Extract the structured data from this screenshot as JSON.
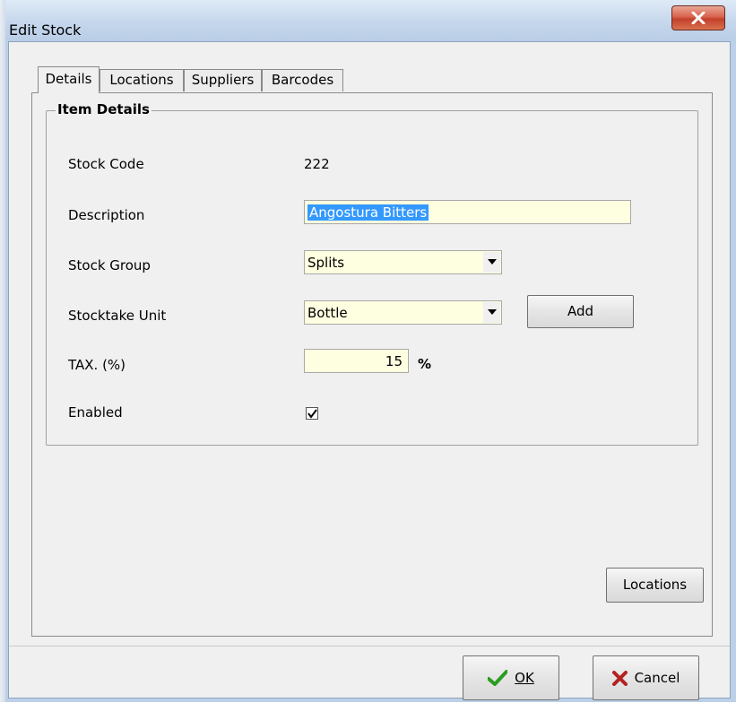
{
  "window": {
    "title": "Edit Stock",
    "close_label": "X"
  },
  "tabs": [
    {
      "label": "Details",
      "active": true
    },
    {
      "label": "Locations",
      "active": false
    },
    {
      "label": "Suppliers",
      "active": false
    },
    {
      "label": "Barcodes",
      "active": false
    }
  ],
  "item_details": {
    "group_title": "Item Details",
    "stock_code": {
      "label": "Stock Code",
      "value": "222"
    },
    "description": {
      "label": "Description",
      "value": "Angostura Bitters"
    },
    "stock_group": {
      "label": "Stock Group",
      "value": "Splits"
    },
    "stocktake_unit": {
      "label": "Stocktake Unit",
      "value": "Bottle",
      "add_label": "Add"
    },
    "tax": {
      "label": "TAX. (%)",
      "value": "15",
      "unit": "%"
    },
    "enabled": {
      "label": "Enabled",
      "checked": true
    }
  },
  "panel": {
    "locations_button": "Locations"
  },
  "footer": {
    "ok_label": "OK",
    "cancel_label": "Cancel"
  },
  "colors": {
    "field_bg": "#fefee0",
    "selection": "#3399ff",
    "ok_check": "#2a9d1f",
    "cancel_x": "#b22222"
  },
  "icons": [
    "close-icon",
    "dropdown-arrow-icon",
    "checkmark-icon",
    "ok-check-icon",
    "cancel-x-icon"
  ]
}
